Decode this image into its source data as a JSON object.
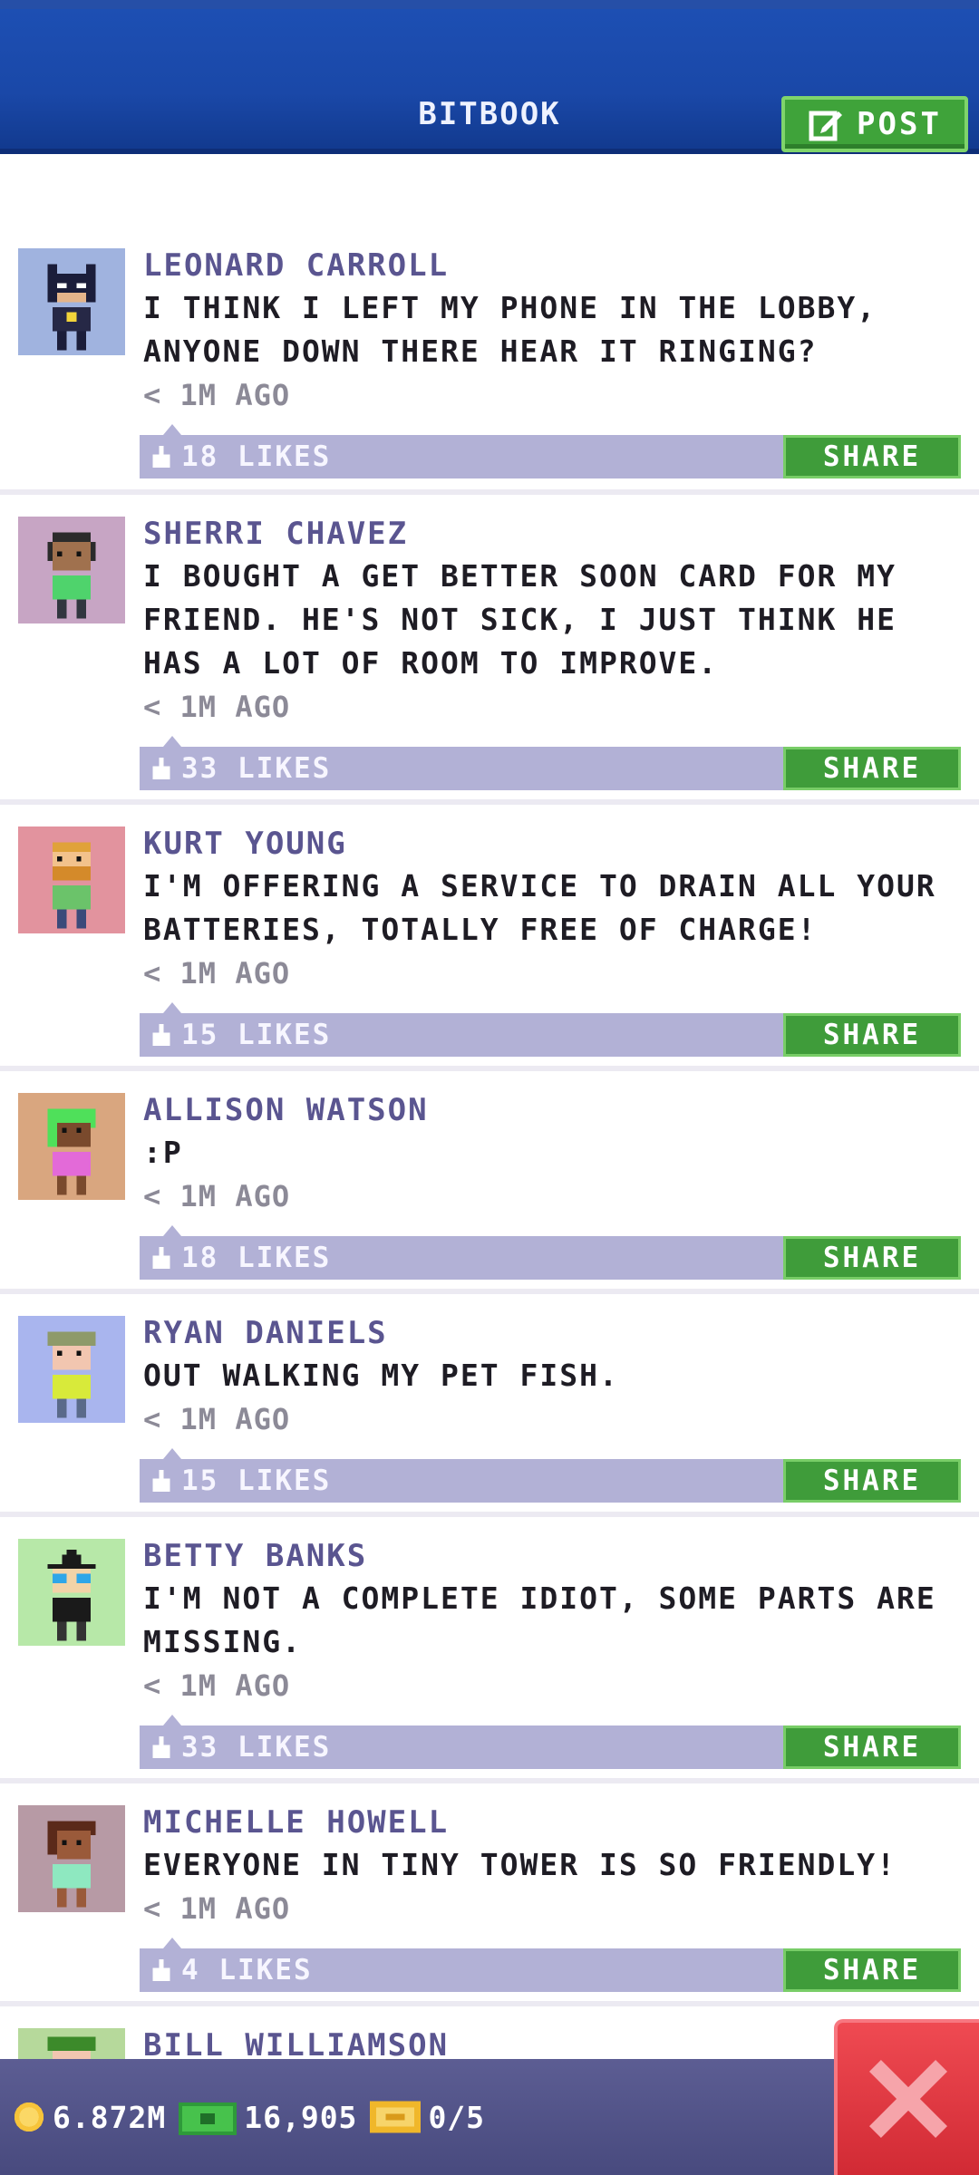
{
  "header": {
    "title": "BITBOOK",
    "post_label": "POST"
  },
  "posts": [
    {
      "name": "LEONARD CARROLL",
      "message": "I THINK I LEFT MY PHONE IN THE LOBBY, ANYONE DOWN THERE HEAR IT RINGING?",
      "time": "< 1M AGO",
      "likes": "18 LIKES",
      "share": "SHARE",
      "avatar_bg": "#a0b3df"
    },
    {
      "name": "SHERRI CHAVEZ",
      "message": "I BOUGHT A GET BETTER SOON CARD FOR MY FRIEND. HE'S NOT SICK, I JUST THINK HE HAS A LOT OF ROOM TO IMPROVE.",
      "time": "< 1M AGO",
      "likes": "33 LIKES",
      "share": "SHARE",
      "avatar_bg": "#c7a5c4"
    },
    {
      "name": "KURT YOUNG",
      "message": "I'M OFFERING A SERVICE TO DRAIN ALL YOUR BATTERIES, TOTALLY FREE OF CHARGE!",
      "time": "< 1M AGO",
      "likes": "15 LIKES",
      "share": "SHARE",
      "avatar_bg": "#e2939e"
    },
    {
      "name": "ALLISON WATSON",
      "message": ":P",
      "time": "< 1M AGO",
      "likes": "18 LIKES",
      "share": "SHARE",
      "avatar_bg": "#d9a67f"
    },
    {
      "name": "RYAN DANIELS",
      "message": "OUT WALKING MY PET FISH.",
      "time": "< 1M AGO",
      "likes": "15 LIKES",
      "share": "SHARE",
      "avatar_bg": "#a9b5ee"
    },
    {
      "name": "BETTY BANKS",
      "message": "I'M NOT A COMPLETE IDIOT, SOME PARTS ARE MISSING.",
      "time": "< 1M AGO",
      "likes": "33 LIKES",
      "share": "SHARE",
      "avatar_bg": "#b7e8a8"
    },
    {
      "name": "MICHELLE HOWELL",
      "message": "EVERYONE IN TINY TOWER IS SO FRIENDLY!",
      "time": "< 1M AGO",
      "likes": "4 LIKES",
      "share": "SHARE",
      "avatar_bg": "#b79aa5"
    },
    {
      "name": "BILL WILLIAMSON",
      "avatar_bg": "#b6d99b"
    }
  ],
  "footer": {
    "coins": "6.872M",
    "bux": "16,905",
    "tickets": "0/5"
  },
  "colors": {
    "header_blue": "#1a48a8",
    "share_green": "#3f9c3a",
    "likes_bar": "#b2b1d6",
    "name_purple": "#5a5590",
    "close_red": "#e03a44"
  }
}
